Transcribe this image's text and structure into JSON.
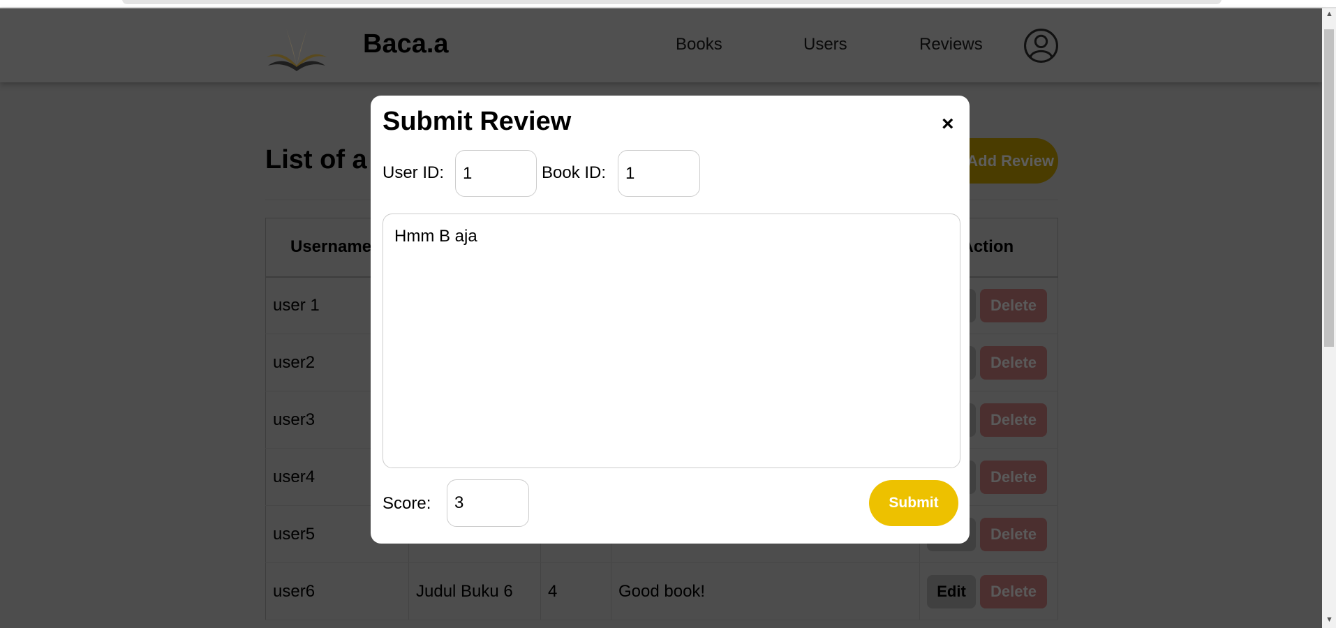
{
  "header": {
    "brand": "Baca.a",
    "nav": [
      "Books",
      "Users",
      "Reviews"
    ]
  },
  "main": {
    "title": "List of a",
    "add_button": "Add Review",
    "table": {
      "headers": {
        "username": "Username",
        "action": "Action"
      },
      "rows": [
        {
          "username": "user 1",
          "book": "",
          "score": "",
          "review": ""
        },
        {
          "username": "user2",
          "book": "",
          "score": "",
          "review": ""
        },
        {
          "username": "user3",
          "book": "",
          "score": "",
          "review": ""
        },
        {
          "username": "user4",
          "book": "",
          "score": "",
          "review": ""
        },
        {
          "username": "user5",
          "book": "",
          "score": "",
          "review": ""
        },
        {
          "username": "user6",
          "book": "Judul Buku 6",
          "score": "4",
          "review": "Good book!"
        }
      ],
      "edit_label": "Edit",
      "delete_label": "Delete"
    }
  },
  "modal": {
    "title": "Submit Review",
    "close": "×",
    "user_id_label": "User ID:",
    "user_id": "1",
    "book_id_label": "Book ID:",
    "book_id": "1",
    "review_text": "Hmm B aja",
    "score_label": "Score:",
    "score": "3",
    "submit": "Submit"
  },
  "colors": {
    "accent": "#edc100",
    "delete": "#e57373"
  }
}
